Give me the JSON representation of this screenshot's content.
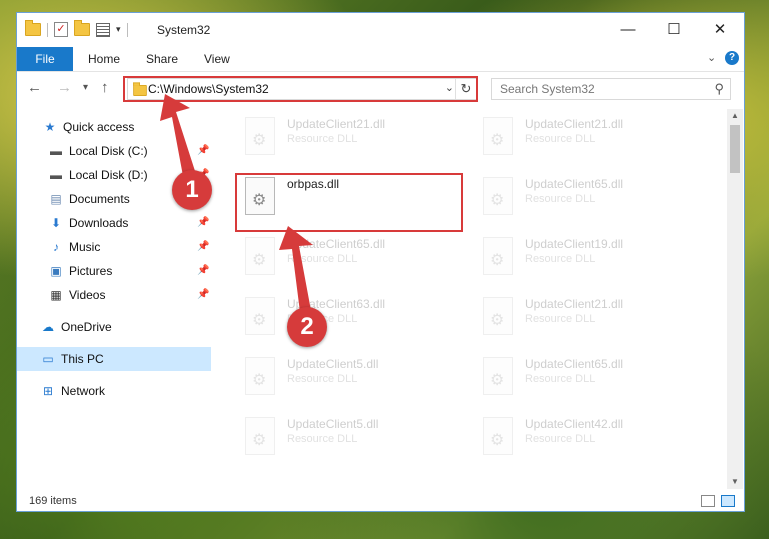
{
  "window": {
    "title": "System32",
    "controls": {
      "minimize": "—",
      "maximize": "☐",
      "close": "✕"
    }
  },
  "ribbon": {
    "tabs": [
      "File",
      "Home",
      "Share",
      "View"
    ],
    "help": "?"
  },
  "address": {
    "path": "C:\\Windows\\System32",
    "search_placeholder": "Search System32"
  },
  "sidebar": {
    "items": [
      {
        "label": "Quick access",
        "icon": "star-icon"
      },
      {
        "label": "Local Disk (C:)",
        "icon": "drive-icon",
        "pinned": true
      },
      {
        "label": "Local Disk (D:)",
        "icon": "drive-icon",
        "pinned": true
      },
      {
        "label": "Documents",
        "icon": "documents-icon",
        "pinned": true
      },
      {
        "label": "Downloads",
        "icon": "download-arrow-icon",
        "pinned": true
      },
      {
        "label": "Music",
        "icon": "music-note-icon",
        "pinned": true
      },
      {
        "label": "Pictures",
        "icon": "pictures-icon",
        "pinned": true
      },
      {
        "label": "Videos",
        "icon": "film-icon",
        "pinned": true
      },
      {
        "label": "OneDrive",
        "icon": "cloud-icon"
      },
      {
        "label": "This PC",
        "icon": "monitor-icon",
        "selected": true
      },
      {
        "label": "Network",
        "icon": "network-icon"
      }
    ]
  },
  "files": {
    "highlighted": {
      "name": "orbpas.dll"
    },
    "left_column": [
      {
        "name": "UpdateClient21.dll",
        "type": "Resource DLL"
      },
      {
        "name": "UpdateClient65.dll",
        "type": "Resource DLL"
      },
      {
        "name": "UpdateClient63.dll",
        "type": "Resource DLL"
      },
      {
        "name": "UpdateClient5.dll",
        "type": "Resource DLL"
      },
      {
        "name": "UpdateClient5.dll",
        "type": "Resource DLL"
      }
    ],
    "right_column": [
      {
        "name": "UpdateClient21.dll",
        "type": "Resource DLL"
      },
      {
        "name": "UpdateClient65.dll",
        "type": "Resource DLL"
      },
      {
        "name": "UpdateClient19.dll",
        "type": "Resource DLL"
      },
      {
        "name": "UpdateClient21.dll",
        "type": "Resource DLL"
      },
      {
        "name": "UpdateClient65.dll",
        "type": "Resource DLL"
      },
      {
        "name": "UpdateClient42.dll",
        "type": "Resource DLL"
      }
    ]
  },
  "status": {
    "count": "169 items"
  },
  "annotations": {
    "step1": "1",
    "step2": "2",
    "color": "#d63b3b"
  }
}
